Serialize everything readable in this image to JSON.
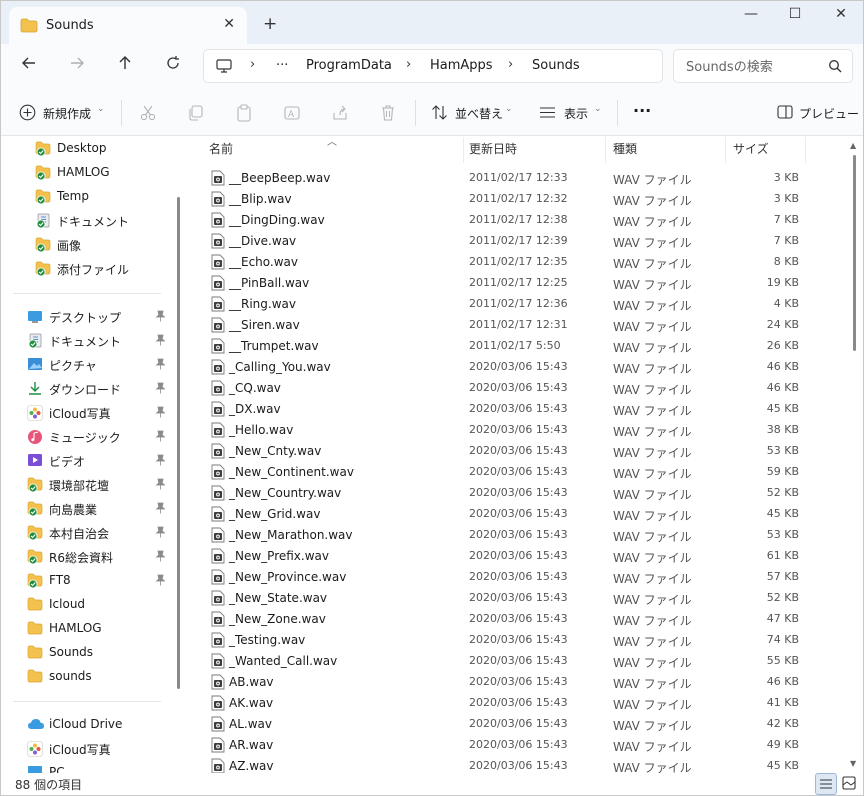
{
  "window": {
    "tab_title": "Sounds",
    "new_tab": "+",
    "controls": {
      "minimize": "—",
      "maximize": "☐",
      "close": "✕"
    },
    "tab_close": "✕"
  },
  "address": {
    "ellipsis": "···",
    "breadcrumbs": [
      "ProgramData",
      "HamApps",
      "Sounds"
    ],
    "search_placeholder": "Soundsの検索"
  },
  "toolbar": {
    "new_label": "新規作成",
    "sort_label": "並べ替え",
    "view_label": "表示",
    "more": "···",
    "preview_label": "プレビュー"
  },
  "sidebar": {
    "quick_items": [
      {
        "label": "Desktop",
        "icon": "folder-synced-icon"
      },
      {
        "label": "HAMLOG",
        "icon": "folder-synced-icon"
      },
      {
        "label": "Temp",
        "icon": "folder-synced-icon"
      },
      {
        "label": "ドキュメント",
        "icon": "documents-synced-icon"
      },
      {
        "label": "画像",
        "icon": "folder-synced-icon"
      },
      {
        "label": "添付ファイル",
        "icon": "folder-synced-icon"
      }
    ],
    "pinned_items": [
      {
        "label": "デスクトップ",
        "icon": "desktop-icon",
        "pinned": true
      },
      {
        "label": "ドキュメント",
        "icon": "documents-synced-icon",
        "pinned": true
      },
      {
        "label": "ピクチャ",
        "icon": "pictures-icon",
        "pinned": true
      },
      {
        "label": "ダウンロード",
        "icon": "download-icon",
        "pinned": true
      },
      {
        "label": "iCloud写真",
        "icon": "icloud-photos-icon",
        "pinned": true
      },
      {
        "label": "ミュージック",
        "icon": "music-icon",
        "pinned": true
      },
      {
        "label": "ビデオ",
        "icon": "video-icon",
        "pinned": true
      },
      {
        "label": "環境部花壇",
        "icon": "folder-synced-icon",
        "pinned": true
      },
      {
        "label": "向島農業",
        "icon": "folder-synced-icon",
        "pinned": true
      },
      {
        "label": "本村自治会",
        "icon": "folder-synced-icon",
        "pinned": true
      },
      {
        "label": "R6総会資料",
        "icon": "folder-synced-icon",
        "pinned": true
      },
      {
        "label": "FT8",
        "icon": "folder-synced-icon",
        "pinned": true
      },
      {
        "label": "Icloud",
        "icon": "folder-icon",
        "pinned": false
      },
      {
        "label": "HAMLOG",
        "icon": "folder-icon",
        "pinned": false
      },
      {
        "label": "Sounds",
        "icon": "folder-icon",
        "pinned": false
      },
      {
        "label": "sounds",
        "icon": "folder-icon",
        "pinned": false
      }
    ],
    "cloud_items": [
      {
        "label": "iCloud Drive",
        "icon": "icloud-drive-icon"
      },
      {
        "label": "iCloud写真",
        "icon": "icloud-photos-icon"
      },
      {
        "label": "PC",
        "icon": "pc-icon"
      }
    ]
  },
  "columns": {
    "name": "名前",
    "date": "更新日時",
    "type": "種類",
    "size": "サイズ"
  },
  "files": [
    {
      "name": "__BeepBeep.wav",
      "date": "2011/02/17 12:33",
      "type": "WAV ファイル",
      "size": "3 KB"
    },
    {
      "name": "__Blip.wav",
      "date": "2011/02/17 12:32",
      "type": "WAV ファイル",
      "size": "3 KB"
    },
    {
      "name": "__DingDing.wav",
      "date": "2011/02/17 12:38",
      "type": "WAV ファイル",
      "size": "7 KB"
    },
    {
      "name": "__Dive.wav",
      "date": "2011/02/17 12:39",
      "type": "WAV ファイル",
      "size": "7 KB"
    },
    {
      "name": "__Echo.wav",
      "date": "2011/02/17 12:35",
      "type": "WAV ファイル",
      "size": "8 KB"
    },
    {
      "name": "__PinBall.wav",
      "date": "2011/02/17 12:25",
      "type": "WAV ファイル",
      "size": "19 KB"
    },
    {
      "name": "__Ring.wav",
      "date": "2011/02/17 12:36",
      "type": "WAV ファイル",
      "size": "4 KB"
    },
    {
      "name": "__Siren.wav",
      "date": "2011/02/17 12:31",
      "type": "WAV ファイル",
      "size": "24 KB"
    },
    {
      "name": "__Trumpet.wav",
      "date": "2011/02/17 5:50",
      "type": "WAV ファイル",
      "size": "26 KB"
    },
    {
      "name": "_Calling_You.wav",
      "date": "2020/03/06 15:43",
      "type": "WAV ファイル",
      "size": "46 KB"
    },
    {
      "name": "_CQ.wav",
      "date": "2020/03/06 15:43",
      "type": "WAV ファイル",
      "size": "46 KB"
    },
    {
      "name": "_DX.wav",
      "date": "2020/03/06 15:43",
      "type": "WAV ファイル",
      "size": "45 KB"
    },
    {
      "name": "_Hello.wav",
      "date": "2020/03/06 15:43",
      "type": "WAV ファイル",
      "size": "38 KB"
    },
    {
      "name": "_New_Cnty.wav",
      "date": "2020/03/06 15:43",
      "type": "WAV ファイル",
      "size": "53 KB"
    },
    {
      "name": "_New_Continent.wav",
      "date": "2020/03/06 15:43",
      "type": "WAV ファイル",
      "size": "59 KB"
    },
    {
      "name": "_New_Country.wav",
      "date": "2020/03/06 15:43",
      "type": "WAV ファイル",
      "size": "52 KB"
    },
    {
      "name": "_New_Grid.wav",
      "date": "2020/03/06 15:43",
      "type": "WAV ファイル",
      "size": "45 KB"
    },
    {
      "name": "_New_Marathon.wav",
      "date": "2020/03/06 15:43",
      "type": "WAV ファイル",
      "size": "53 KB"
    },
    {
      "name": "_New_Prefix.wav",
      "date": "2020/03/06 15:43",
      "type": "WAV ファイル",
      "size": "61 KB"
    },
    {
      "name": "_New_Province.wav",
      "date": "2020/03/06 15:43",
      "type": "WAV ファイル",
      "size": "57 KB"
    },
    {
      "name": "_New_State.wav",
      "date": "2020/03/06 15:43",
      "type": "WAV ファイル",
      "size": "52 KB"
    },
    {
      "name": "_New_Zone.wav",
      "date": "2020/03/06 15:43",
      "type": "WAV ファイル",
      "size": "47 KB"
    },
    {
      "name": "_Testing.wav",
      "date": "2020/03/06 15:43",
      "type": "WAV ファイル",
      "size": "74 KB"
    },
    {
      "name": "_Wanted_Call.wav",
      "date": "2020/03/06 15:43",
      "type": "WAV ファイル",
      "size": "55 KB"
    },
    {
      "name": "AB.wav",
      "date": "2020/03/06 15:43",
      "type": "WAV ファイル",
      "size": "46 KB"
    },
    {
      "name": "AK.wav",
      "date": "2020/03/06 15:43",
      "type": "WAV ファイル",
      "size": "41 KB"
    },
    {
      "name": "AL.wav",
      "date": "2020/03/06 15:43",
      "type": "WAV ファイル",
      "size": "42 KB"
    },
    {
      "name": "AR.wav",
      "date": "2020/03/06 15:43",
      "type": "WAV ファイル",
      "size": "49 KB"
    },
    {
      "name": "AZ.wav",
      "date": "2020/03/06 15:43",
      "type": "WAV ファイル",
      "size": "45 KB"
    }
  ],
  "status": {
    "item_count": "88 個の項目"
  },
  "colors": {
    "folder": "#f2c14e",
    "sync_check": "#1e8e3e",
    "accent": "#005fb8",
    "chrome_bg": "#eaf0f7"
  }
}
